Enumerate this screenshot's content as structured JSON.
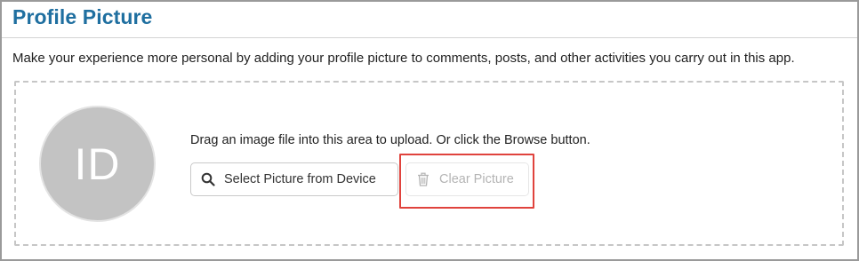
{
  "section": {
    "title": "Profile Picture",
    "description": "Make your experience more personal by adding your profile picture to comments, posts, and other activities you carry out in this app."
  },
  "upload": {
    "avatar_initials": "ID",
    "hint": "Drag an image file into this area to upload. Or click the Browse button.",
    "select_button_label": "Select Picture from Device",
    "select_button_icon": "search-icon",
    "clear_button_label": "Clear Picture",
    "clear_button_icon": "trash-icon",
    "clear_button_disabled": true
  },
  "colors": {
    "title": "#1f6fa0",
    "avatar_bg": "#c3c3c3",
    "highlight": "#e0433d",
    "disabled_text": "#b4b4b4"
  }
}
